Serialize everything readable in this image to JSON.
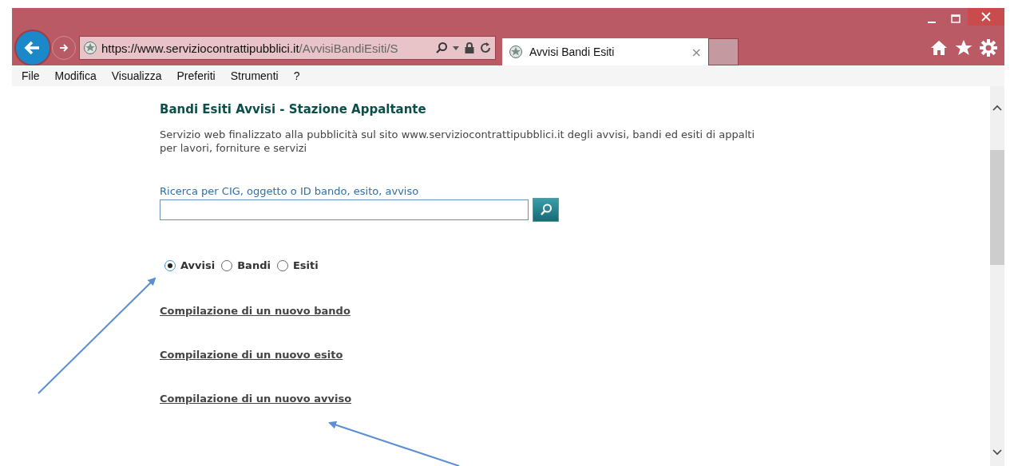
{
  "address_bar": {
    "url_host": "https://www.serviziocontrattipubblici.it",
    "url_path": "/AvvisiBandiEsiti/S"
  },
  "tabs": [
    {
      "label": "Avvisi Bandi Esiti",
      "selected": true,
      "close": "×"
    }
  ],
  "menu": [
    "File",
    "Modifica",
    "Visualizza",
    "Preferiti",
    "Strumenti",
    "?"
  ],
  "page": {
    "title": "Bandi Esiti Avvisi - Stazione Appaltante",
    "description": "Servizio web finalizzato alla pubblicità sul sito www.serviziocontrattipubblici.it degli avvisi, bandi ed esiti di appalti per lavori, forniture e servizi",
    "search": {
      "label": "Ricerca per CIG, oggetto o ID bando, esito, avviso"
    },
    "radios": [
      {
        "label": "Avvisi",
        "selected": true
      },
      {
        "label": "Bandi",
        "selected": false
      },
      {
        "label": "Esiti",
        "selected": false
      }
    ],
    "links": [
      "Compilazione di un nuovo bando",
      "Compilazione di un nuovo esito",
      "Compilazione di un nuovo avviso"
    ]
  }
}
